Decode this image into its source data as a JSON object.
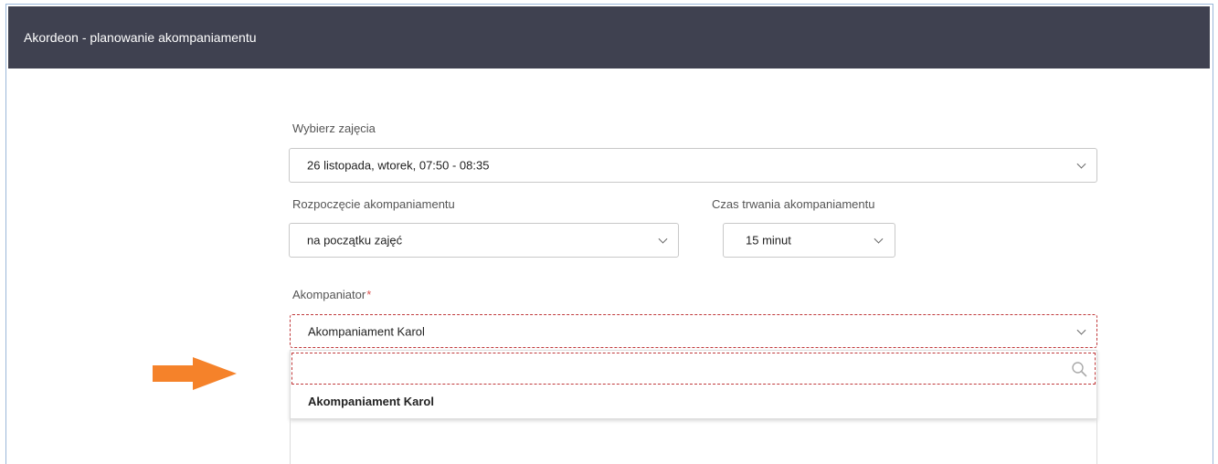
{
  "window": {
    "title": "Akordeon - planowanie akompaniamentu"
  },
  "form": {
    "class_select": {
      "label": "Wybierz zajęcia",
      "value": "26 listopada, wtorek, 07:50 - 08:35"
    },
    "start_select": {
      "label": "Rozpoczęcie akompaniamentu",
      "value": "na początku zajęć"
    },
    "duration_select": {
      "label": "Czas trwania akompaniamentu",
      "value": "15 minut"
    },
    "accompanist_select": {
      "label": "Akompaniator",
      "required_mark": "*",
      "value": "Akompaniament Karol",
      "search_value": "",
      "options": [
        "Akompaniament Karol"
      ]
    }
  },
  "colors": {
    "header_bg": "#3f4150",
    "error_border": "#c0393b",
    "pointer_arrow": "#f5822a"
  },
  "icons": [
    "chevron-down-icon",
    "search-icon",
    "pointer-arrow-icon"
  ]
}
